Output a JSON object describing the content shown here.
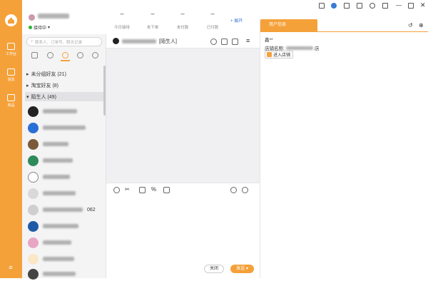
{
  "rail": {
    "items": [
      {
        "label": "工作台"
      },
      {
        "label": "消息"
      },
      {
        "label": "商品"
      }
    ],
    "menu": "≡"
  },
  "header": {
    "status": "接待中",
    "stats": [
      {
        "num": "–",
        "label": "今日接待"
      },
      {
        "num": "–",
        "label": "未下单"
      },
      {
        "num": "–",
        "label": "未付款"
      },
      {
        "num": "–",
        "label": "已付款"
      }
    ],
    "expand": "+ 展开"
  },
  "search": {
    "placeholder": "联系人、订单号、聊天记录"
  },
  "groups": [
    {
      "label": "未分组好友 (21)"
    },
    {
      "label": "淘宝好友 (8)"
    },
    {
      "label": "陌生人 (49)"
    }
  ],
  "contacts": [
    {
      "suffix": ""
    },
    {
      "suffix": ""
    },
    {
      "suffix": ""
    },
    {
      "suffix": ""
    },
    {
      "suffix": ""
    },
    {
      "suffix": ""
    },
    {
      "suffix": "062"
    },
    {
      "suffix": ""
    },
    {
      "suffix": ""
    },
    {
      "suffix": ""
    },
    {
      "suffix": ""
    }
  ],
  "chat": {
    "tag": "[陌生人]",
    "close": "关闭",
    "send": "发送"
  },
  "info": {
    "tab": "用户信息",
    "line1": "鑫**",
    "shop_label": "店铺名称:",
    "shop_suffix": "店",
    "enter": "进入店铺"
  },
  "colors": {
    "accent": "#f5a13a",
    "online": "#2cb52c",
    "link": "#3a7bd5"
  }
}
